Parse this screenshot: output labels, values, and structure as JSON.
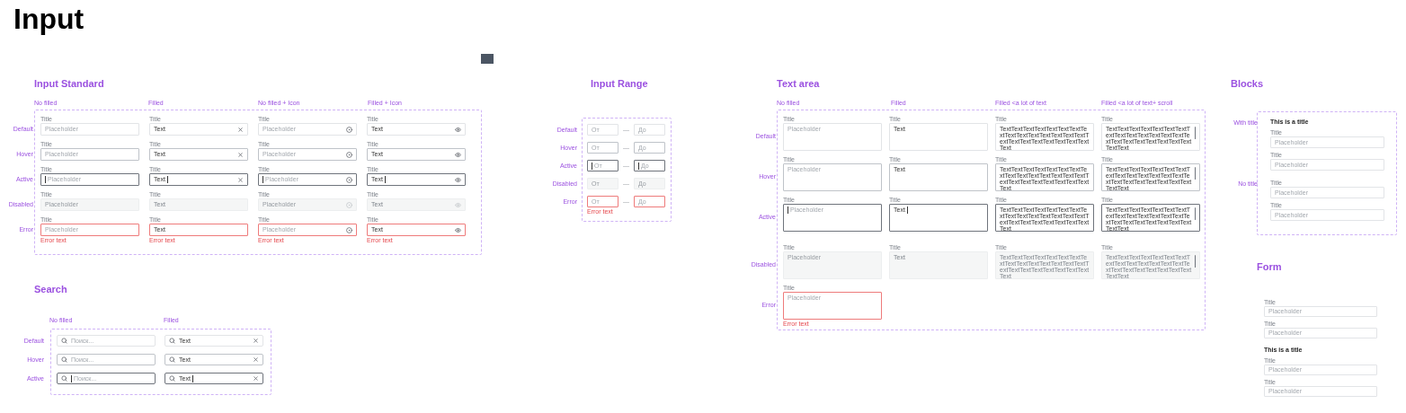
{
  "page_title": "Input",
  "input_standard": {
    "title": "Input Standard",
    "columns": [
      "No filled",
      "Filled",
      "No filled + Icon",
      "Filled + Icon"
    ],
    "rows": [
      {
        "label": "Default",
        "kind": "default",
        "cells": [
          {
            "title": "Title",
            "placeholder": "Placeholder"
          },
          {
            "title": "Title",
            "value": "Text",
            "kind": "clearable"
          },
          {
            "title": "Title",
            "placeholder": "Placeholder",
            "kind": "target"
          },
          {
            "title": "Title",
            "value": "Text",
            "kind": "reveal"
          }
        ]
      },
      {
        "label": "Hover",
        "kind": "hover",
        "cells": [
          {
            "title": "Title",
            "placeholder": "Placeholder"
          },
          {
            "title": "Title",
            "value": "Text",
            "kind": "clearable"
          },
          {
            "title": "Title",
            "placeholder": "Placeholder",
            "kind": "target"
          },
          {
            "title": "Title",
            "value": "Text",
            "kind": "reveal"
          }
        ]
      },
      {
        "label": "Active",
        "kind": "active",
        "cells": [
          {
            "title": "Title",
            "placeholder": "Placeholder"
          },
          {
            "title": "Title",
            "value": "Text",
            "kind": "clearable"
          },
          {
            "title": "Title",
            "placeholder": "Placeholder",
            "kind": "target"
          },
          {
            "title": "Title",
            "value": "Text",
            "kind": "reveal"
          }
        ]
      },
      {
        "label": "Disabled",
        "kind": "disabled",
        "cells": [
          {
            "title": "Title",
            "placeholder": "Placeholder"
          },
          {
            "title": "Title",
            "value": "Text"
          },
          {
            "title": "Title",
            "placeholder": "Placeholder",
            "kind": "target"
          },
          {
            "title": "Title",
            "value": "Text",
            "kind": "reveal"
          }
        ]
      },
      {
        "label": "Error",
        "kind": "error",
        "cells": [
          {
            "title": "Title",
            "placeholder": "Placeholder",
            "error": "Error text"
          },
          {
            "title": "Title",
            "value": "Text",
            "error": "Error text"
          },
          {
            "title": "Title",
            "placeholder": "Placeholder",
            "kind": "target",
            "error": "Error text"
          },
          {
            "title": "Title",
            "value": "Text",
            "kind": "reveal",
            "error": "Error text"
          }
        ]
      }
    ]
  },
  "search": {
    "title": "Search",
    "columns": [
      "No filled",
      "Filled"
    ],
    "rows": [
      {
        "label": "Default",
        "kind": "default",
        "cells": [
          {
            "placeholder": "Поиск..."
          },
          {
            "value": "Text",
            "kind": "clearable"
          }
        ]
      },
      {
        "label": "Hover",
        "kind": "hover",
        "cells": [
          {
            "placeholder": "Поиск..."
          },
          {
            "value": "Text",
            "kind": "clearable"
          }
        ]
      },
      {
        "label": "Active",
        "kind": "active",
        "cells": [
          {
            "placeholder": "Поиск..."
          },
          {
            "value": "Text",
            "kind": "clearable"
          }
        ]
      }
    ]
  },
  "input_range": {
    "title": "Input Range",
    "rows": [
      {
        "label": "Default",
        "kind": "default",
        "from_placeholder": "От",
        "separator": "—",
        "to_placeholder": "До"
      },
      {
        "label": "Hover",
        "kind": "hover",
        "from_placeholder": "От",
        "separator": "—",
        "to_placeholder": "До"
      },
      {
        "label": "Active",
        "kind": "active",
        "from_placeholder": "От",
        "separator": "—",
        "to_placeholder": "До"
      },
      {
        "label": "Disabled",
        "kind": "disabled",
        "from_placeholder": "От",
        "separator": "—",
        "to_placeholder": "До"
      },
      {
        "label": "Error",
        "kind": "error",
        "from_placeholder": "От",
        "separator": "—",
        "to_placeholder": "До",
        "error": "Error text"
      }
    ]
  },
  "text_area": {
    "title": "Text area",
    "columns": [
      "No filled",
      "Filled",
      "Filled <a lot of text",
      "Filled <a lot of text+ scroll"
    ],
    "rows": [
      {
        "label": "Default",
        "kind": "default",
        "cells": [
          {
            "title": "Title",
            "placeholder": "Placeholder"
          },
          {
            "title": "Title",
            "value": "Text"
          },
          {
            "title": "Title",
            "value": "TextTextTextTextTextTextTextTextTextTextTextTextTextTextTextTextTextTextTextTextTextTextTextText"
          },
          {
            "title": "Title",
            "value": "TextTextTextTextTextTextTextTextTextTextTextTextTextTextTextTextTextTextTextTextTextTextTextText",
            "scroll": true
          }
        ]
      },
      {
        "label": "Hover",
        "kind": "hover",
        "cells": [
          {
            "title": "Title",
            "placeholder": "Placeholder"
          },
          {
            "title": "Title",
            "value": "Text"
          },
          {
            "title": "Title",
            "value": "TextTextTextTextTextTextTextTextTextTextTextTextTextTextTextTextTextTextTextTextTextTextTextText"
          },
          {
            "title": "Title",
            "value": "TextTextTextTextTextTextTextTextTextTextTextTextTextTextTextTextTextTextTextTextTextTextTextText",
            "scroll": true
          }
        ]
      },
      {
        "label": "Active",
        "kind": "active",
        "cells": [
          {
            "title": "Title",
            "placeholder": "Placeholder"
          },
          {
            "title": "Title",
            "value": "Text"
          },
          {
            "title": "Title",
            "value": "TextTextTextTextTextTextTextTextTextTextTextTextTextTextTextTextTextTextTextTextTextTextTextText"
          },
          {
            "title": "Title",
            "value": "TextTextTextTextTextTextTextTextTextTextTextTextTextTextTextTextTextTextTextTextTextTextTextText",
            "scroll": true
          }
        ]
      },
      {
        "label": "Disabled",
        "kind": "disabled",
        "cells": [
          {
            "title": "Title",
            "placeholder": "Placeholder"
          },
          {
            "title": "Title",
            "value": "Text"
          },
          {
            "title": "Title",
            "value": "TextTextTextTextTextTextTextTextTextTextTextTextTextTextTextTextTextTextTextTextTextTextTextText"
          },
          {
            "title": "Title",
            "value": "TextTextTextTextTextTextTextTextTextTextTextTextTextTextTextTextTextTextTextTextTextTextTextText",
            "scroll": true
          }
        ]
      },
      {
        "label": "Error",
        "kind": "error",
        "cells": [
          {
            "title": "Title",
            "placeholder": "Placeholder",
            "error": "Error text"
          }
        ]
      }
    ]
  },
  "blocks": {
    "title": "Blocks",
    "items": [
      {
        "label": "With title",
        "heading": "This is a title",
        "fields": [
          {
            "title": "Title",
            "placeholder": "Placeholder"
          },
          {
            "title": "Title",
            "placeholder": "Placeholder"
          }
        ]
      },
      {
        "label": "No title",
        "fields": [
          {
            "title": "Title",
            "placeholder": "Placeholder"
          },
          {
            "title": "Title",
            "placeholder": "Placeholder"
          }
        ]
      }
    ]
  },
  "form": {
    "title": "Form",
    "groups": [
      {
        "fields": [
          {
            "title": "Title",
            "placeholder": "Placeholder"
          },
          {
            "title": "Title",
            "placeholder": "Placeholder"
          }
        ]
      },
      {
        "heading": "This is a title",
        "fields": [
          {
            "title": "Title",
            "placeholder": "Placeholder"
          },
          {
            "title": "Title",
            "placeholder": "Placeholder"
          }
        ]
      }
    ]
  }
}
